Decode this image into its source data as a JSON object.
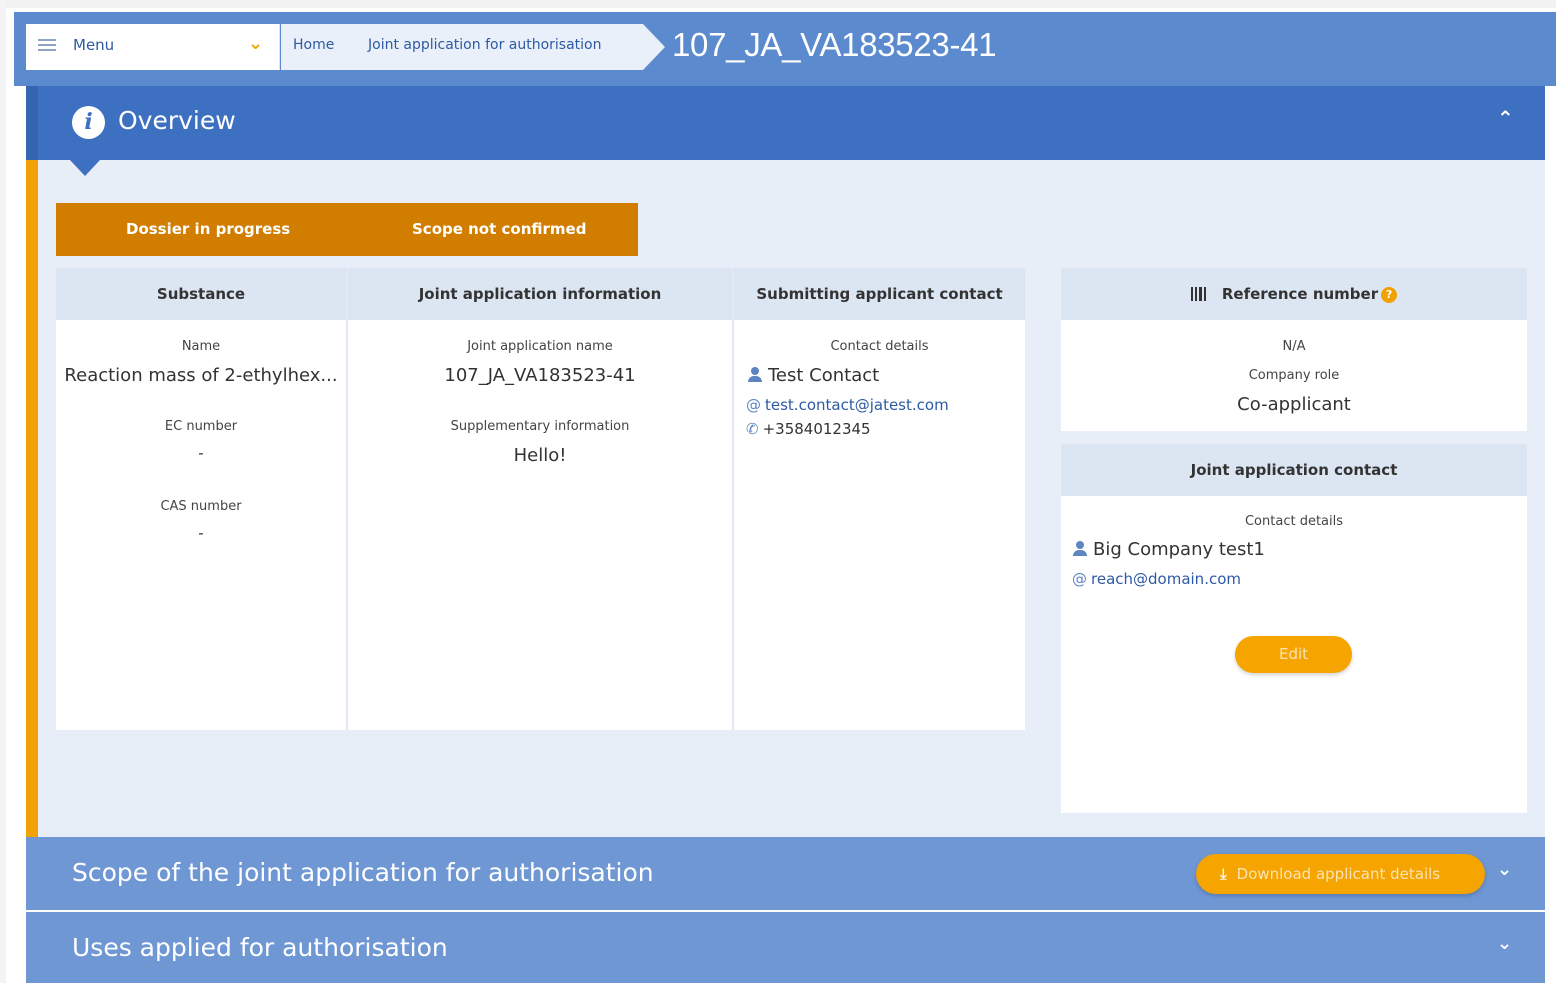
{
  "header": {
    "menu_label": "Menu",
    "breadcrumbs": [
      "Home",
      "Joint application for authorisation"
    ],
    "title": "107_JA_VA183523-41"
  },
  "overview": {
    "title": "Overview",
    "status": [
      "Dossier in progress",
      "Scope not confirmed"
    ],
    "columns": {
      "substance": {
        "header": "Substance",
        "name_label": "Name",
        "name_value": "Reaction mass of 2-ethylhex...",
        "ec_label": "EC number",
        "ec_value": "-",
        "cas_label": "CAS number",
        "cas_value": "-"
      },
      "joint_application": {
        "header": "Joint application information",
        "name_label": "Joint application name",
        "name_value": "107_JA_VA183523-41",
        "supp_label": "Supplementary information",
        "supp_value": "Hello!"
      },
      "submitting_contact": {
        "header": "Submitting applicant contact",
        "details_label": "Contact details",
        "name": "Test Contact",
        "email": "test.contact@jatest.com",
        "phone": "+3584012345"
      }
    },
    "reference": {
      "header": "Reference number",
      "value": "N/A",
      "role_label": "Company role",
      "role_value": "Co-applicant"
    },
    "joint_contact": {
      "header": "Joint application contact",
      "details_label": "Contact details",
      "name": "Big Company test1",
      "email": "reach@domain.com",
      "edit_label": "Edit"
    }
  },
  "sections": {
    "scope_title": "Scope of the joint application for authorisation",
    "download_label": "Download applicant details",
    "uses_title": "Uses applied for authorisation"
  },
  "icons": [
    "hamburger-icon",
    "chevron-down-icon",
    "info-icon",
    "chevron-up-icon",
    "barcode-icon",
    "help-icon",
    "person-icon",
    "at-icon",
    "phone-icon",
    "download-icon"
  ],
  "colors": {
    "header_blue": "#5b8ace",
    "overview_blue": "#3d70c1",
    "status_orange": "#d17d00",
    "button_orange": "#f5a400",
    "section_blue": "#6e97d4"
  }
}
